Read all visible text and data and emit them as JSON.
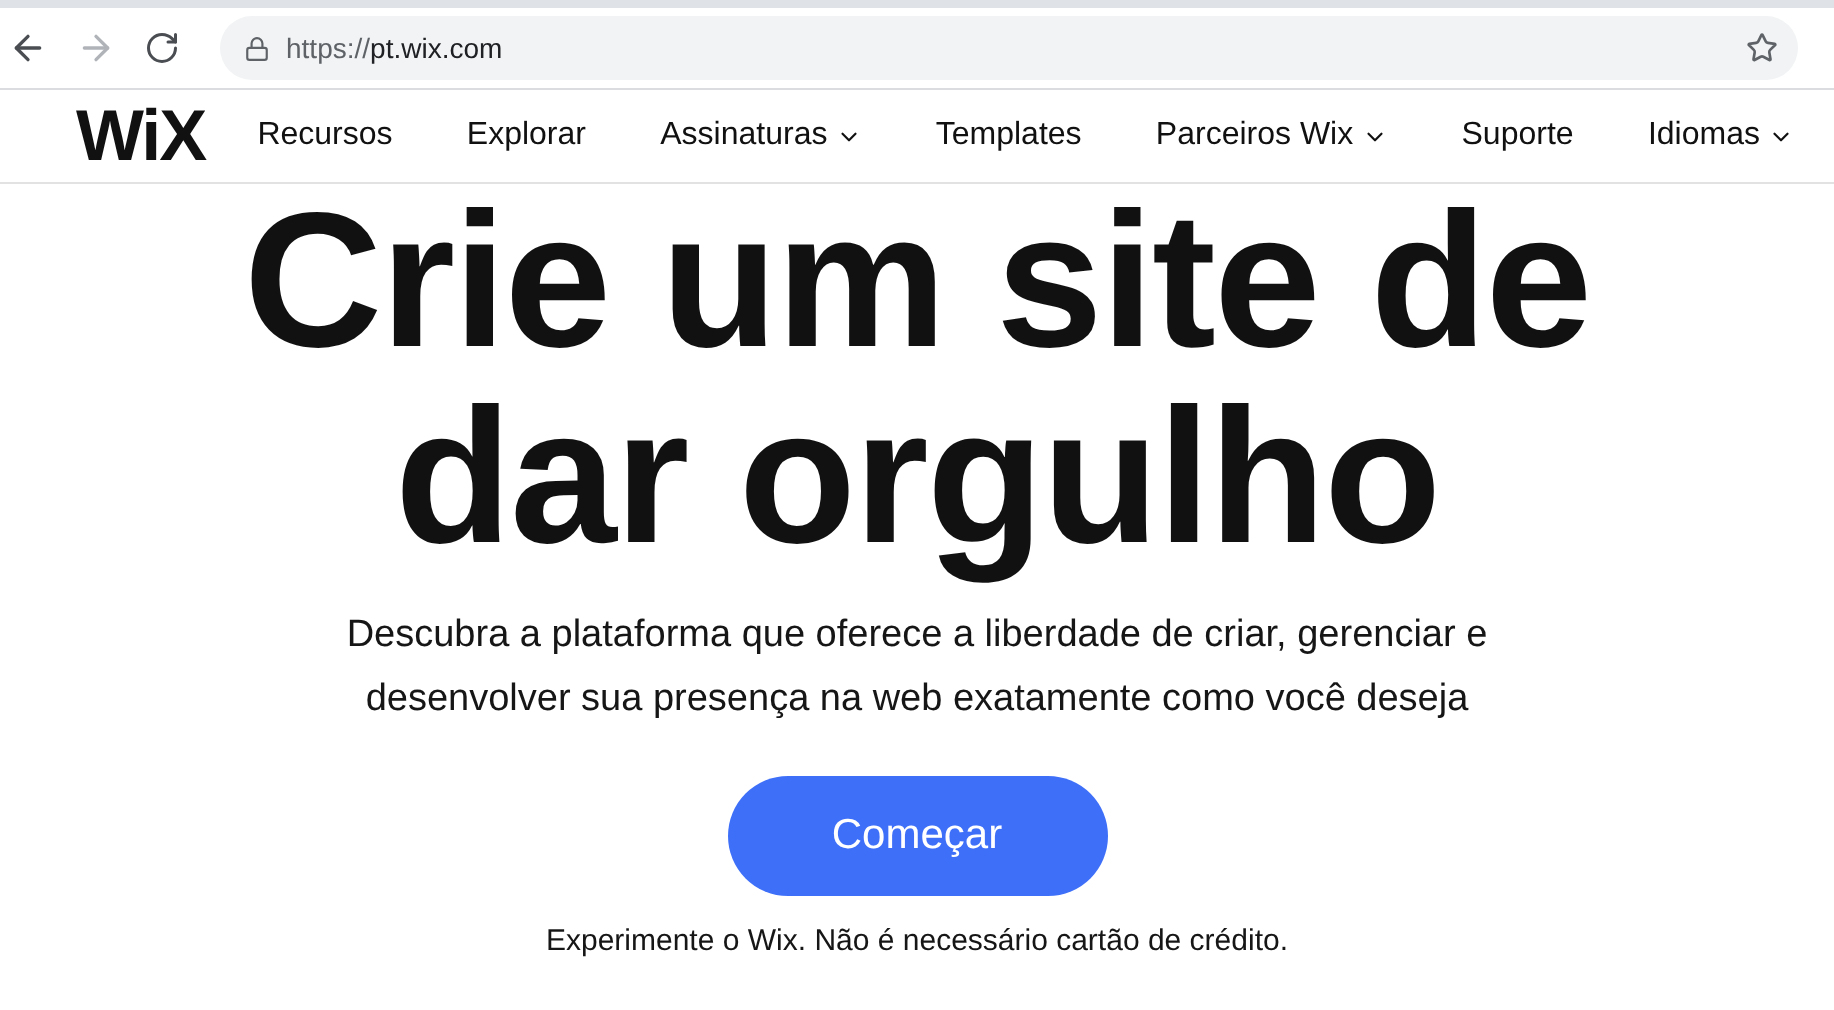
{
  "browser": {
    "url_scheme": "https://",
    "url_host": "pt.wix.com",
    "back_enabled": true,
    "forward_enabled": false
  },
  "nav": {
    "logo": "WiX",
    "items": [
      {
        "label": "Recursos",
        "has_dropdown": false
      },
      {
        "label": "Explorar",
        "has_dropdown": false
      },
      {
        "label": "Assinaturas",
        "has_dropdown": true
      },
      {
        "label": "Templates",
        "has_dropdown": false
      },
      {
        "label": "Parceiros Wix",
        "has_dropdown": true
      },
      {
        "label": "Suporte",
        "has_dropdown": false
      },
      {
        "label": "Idiomas",
        "has_dropdown": true
      }
    ]
  },
  "hero": {
    "headline_lines": [
      "Crie um site de",
      "dar orgulho"
    ],
    "subtitle_lines": [
      "Descubra a plataforma que oferece a liberdade de criar, gerenciar e",
      "desenvolver sua presença na web exatamente como você deseja"
    ],
    "button": "Começar",
    "note": "Experimente o Wix. Não é necessário cartão de crédito."
  }
}
